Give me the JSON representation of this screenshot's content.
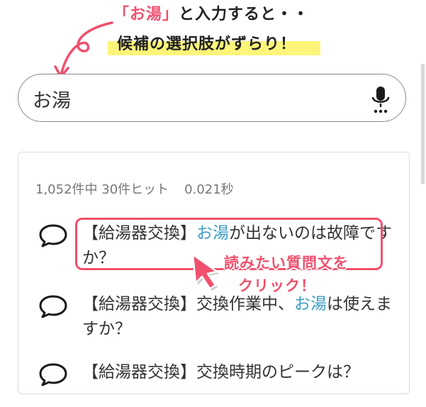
{
  "annotation": {
    "line1_open": "「",
    "line1_keyword": "お湯",
    "line1_close": "」",
    "line1_rest": "と入力すると・・",
    "line2": "候補の選択肢がずらり！",
    "click_hint_line1": "読みたい質問文を",
    "click_hint_line2": "クリック！"
  },
  "search": {
    "value": "お湯"
  },
  "results_meta": {
    "count_text": "1,052件中 30件ヒット",
    "time_text": "0.021秒"
  },
  "results": [
    {
      "pre": "【給湯器交換】",
      "hl": "お湯",
      "post": "が出ないのは故障ですか？"
    },
    {
      "pre": "【給湯器交換】交換作業中、",
      "hl": "お湯",
      "post": "は使えますか？"
    },
    {
      "pre": "【給湯器交換】交換時期のピークは？",
      "hl": "",
      "post": ""
    }
  ],
  "colors": {
    "accent": "#f0506e",
    "highlight_text": "#3d9dc6",
    "marker": "#fdf57a"
  }
}
